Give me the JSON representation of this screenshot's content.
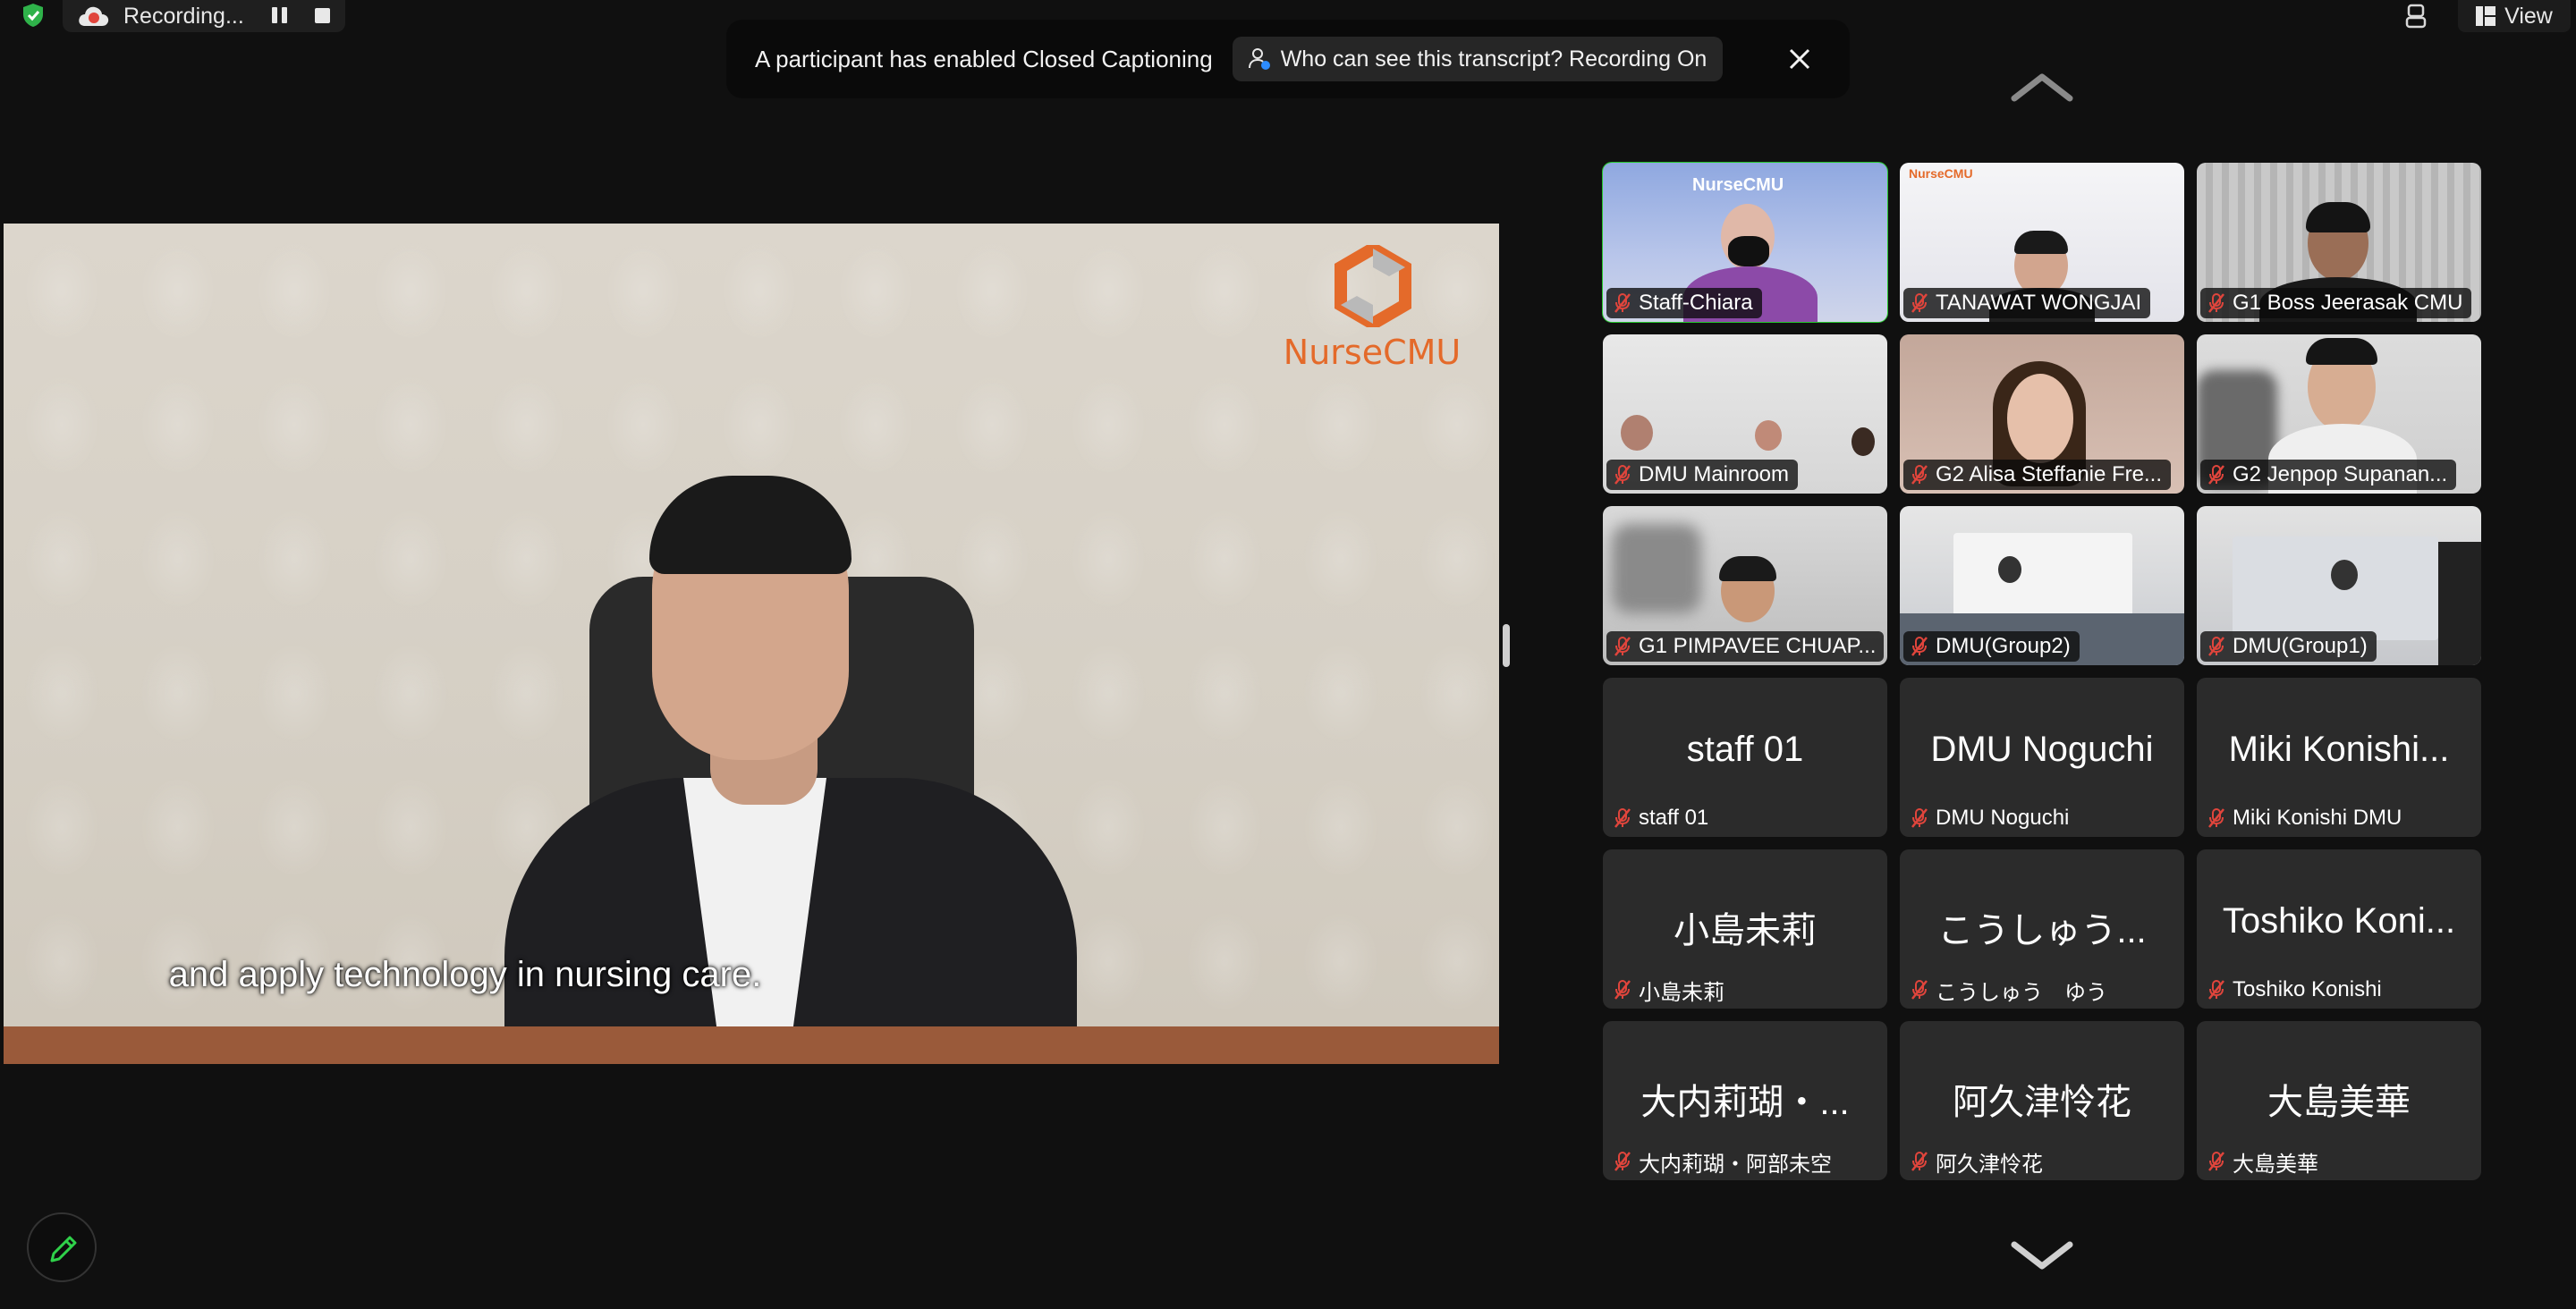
{
  "recording": {
    "label": "Recording..."
  },
  "view_menu": {
    "label": "View"
  },
  "caption_notice": {
    "message": "A participant has enabled Closed Captioning",
    "who_can_see": "Who can see this transcript? Recording On"
  },
  "main_video": {
    "subtitle": "and apply technology in nursing care.",
    "logo_text": "NurseCMU"
  },
  "colors": {
    "active_speaker_border": "#25c72b",
    "mic_muted": "#e0453c",
    "logo_orange": "#e46a2a",
    "background": "#101010"
  },
  "participants": [
    {
      "tag": "Staff-Chiara",
      "video_text": "NurseCMU"
    },
    {
      "tag": "TANAWAT WONGJAI",
      "video_text": "NurseCMU"
    },
    {
      "tag": "G1 Boss Jeerasak CMU"
    },
    {
      "tag": "DMU Mainroom"
    },
    {
      "tag": "G2 Alisa Steffanie Fre..."
    },
    {
      "tag": "G2 Jenpop Supanan..."
    },
    {
      "tag": "G1 PIMPAVEE CHUAP..."
    },
    {
      "tag": "DMU(Group2)"
    },
    {
      "tag": "DMU(Group1)"
    },
    {
      "big": "staff 01",
      "tag": "staff 01"
    },
    {
      "big": "DMU Noguchi",
      "tag": "DMU Noguchi"
    },
    {
      "big": "Miki Konishi...",
      "tag": "Miki Konishi DMU"
    },
    {
      "big": "小島未莉",
      "tag": "小島未莉"
    },
    {
      "big": "こうしゅう...",
      "tag": "こうしゅう　ゆう"
    },
    {
      "big": "Toshiko Koni...",
      "tag": "Toshiko Konishi"
    },
    {
      "big": "大内莉瑚・...",
      "tag": "大内莉瑚・阿部未空"
    },
    {
      "big": "阿久津怜花",
      "tag": "阿久津怜花"
    },
    {
      "big": "大島美華",
      "tag": "大島美華"
    }
  ]
}
